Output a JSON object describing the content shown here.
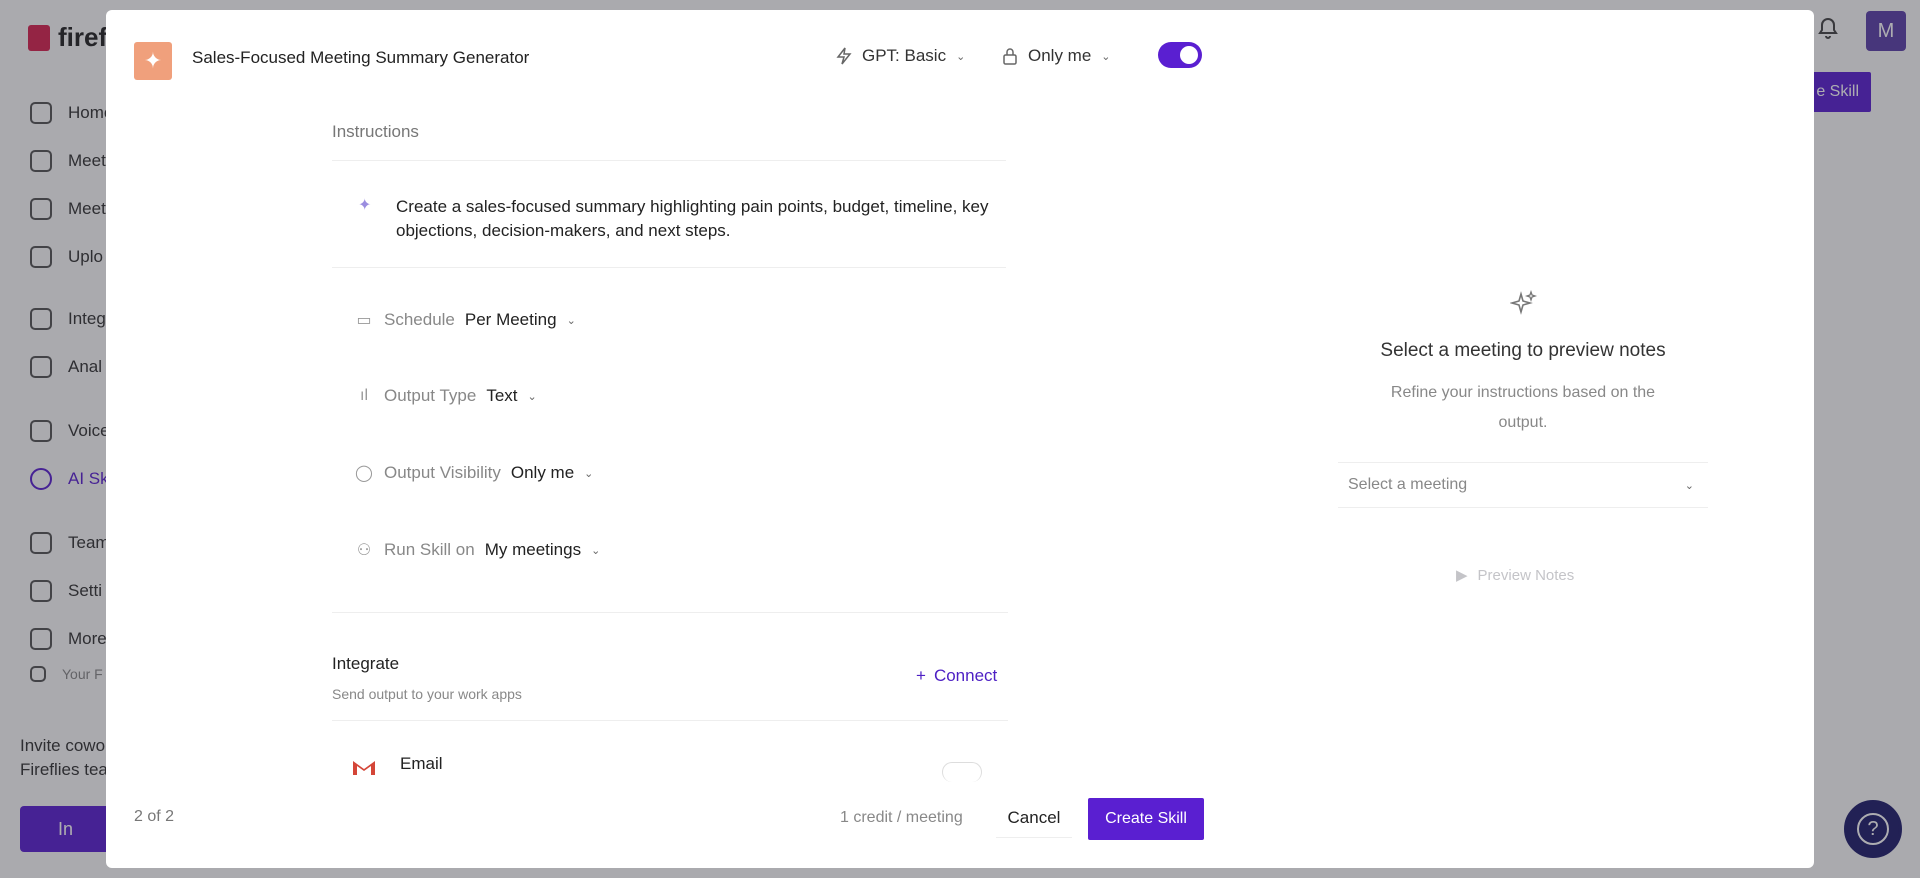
{
  "background": {
    "logo_text": "firef",
    "avatar_initial": "M",
    "create_button_label": "e Skill",
    "nav_items": [
      "Home",
      "Meet",
      "Meet",
      "Uplo",
      "Integ",
      "Anal",
      "Voice",
      "AI Sk",
      "Team",
      "Setti",
      "More",
      "Your F"
    ],
    "invite_text_line1": "Invite cowo",
    "invite_text_line2": "Fireflies tea",
    "invite_button_label": "In"
  },
  "modal": {
    "skill_icon": "sparkle-icon",
    "skill_title": "Sales-Focused Meeting Summary Generator",
    "model_label": "GPT: Basic",
    "visibility_label": "Only me",
    "toggle_on": true,
    "instructions": {
      "label": "Instructions",
      "text": "Create a sales-focused summary highlighting pain points, budget, timeline, key objections, decision-makers, and next steps."
    },
    "settings": [
      {
        "icon": "calendar-icon",
        "label": "Schedule",
        "value": "Per Meeting"
      },
      {
        "icon": "bar-chart-icon",
        "label": "Output Type",
        "value": "Text"
      },
      {
        "icon": "globe-icon",
        "label": "Output Visibility",
        "value": "Only me"
      },
      {
        "icon": "users-icon",
        "label": "Run Skill on",
        "value": "My meetings"
      }
    ],
    "integrate": {
      "title": "Integrate",
      "subtitle": "Send output to your work apps",
      "connect_label": "Connect",
      "email_label": "Email"
    },
    "preview": {
      "title": "Select a meeting to preview notes",
      "subtitle": "Refine your instructions based on the output.",
      "select_placeholder": "Select a meeting",
      "preview_button": "Preview Notes"
    },
    "footer": {
      "step": "2 of 2",
      "credit": "1 credit / meeting",
      "cancel_label": "Cancel",
      "create_label": "Create Skill"
    }
  },
  "colors": {
    "accent": "#5a1fd1",
    "skill_icon_bg": "#f0a07c",
    "help_button": "#1f1d6b"
  }
}
